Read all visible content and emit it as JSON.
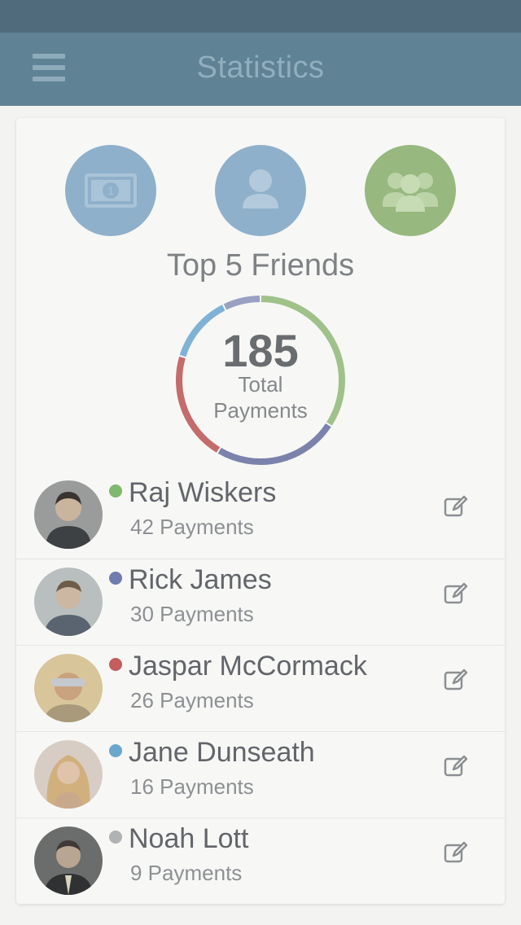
{
  "header": {
    "title": "Statistics",
    "menu_icon": "hamburger-menu-icon"
  },
  "stat_icons": [
    {
      "name": "money-icon",
      "color": "#8fb0cb"
    },
    {
      "name": "single-user-icon",
      "color": "#8fb0cb"
    },
    {
      "name": "group-users-icon",
      "color": "#97b87e"
    }
  ],
  "section": {
    "title": "Top 5 Friends"
  },
  "summary": {
    "total": "185",
    "label_line1": "Total",
    "label_line2": "Payments"
  },
  "chart_data": {
    "type": "pie",
    "categories": [
      "Raj Wiskers",
      "Rick James",
      "Jaspar McCormack",
      "Jane Dunseath",
      "Noah Lott"
    ],
    "values": [
      42,
      30,
      26,
      16,
      9
    ],
    "total": 185
  },
  "friends": [
    {
      "name": "Raj Wiskers",
      "payments": "42 Payments",
      "dot_color": "#7fb86f"
    },
    {
      "name": "Rick James",
      "payments": "30 Payments",
      "dot_color": "#6f7cad"
    },
    {
      "name": "Jaspar McCormack",
      "payments": "26 Payments",
      "dot_color": "#c45d5d"
    },
    {
      "name": "Jane Dunseath",
      "payments": "16 Payments",
      "dot_color": "#6aa7cf"
    },
    {
      "name": "Noah Lott",
      "payments": "9 Payments",
      "dot_color": "#b0b2b3"
    }
  ],
  "colors": {
    "header_bg": "#5f8294",
    "status_bar_bg": "#506c7c",
    "page_bg": "#f3f4f2",
    "donut_colors": [
      "#9fc28a",
      "#7b82ab",
      "#c46b6b",
      "#7eb2d6",
      "#9aa0c2"
    ]
  }
}
